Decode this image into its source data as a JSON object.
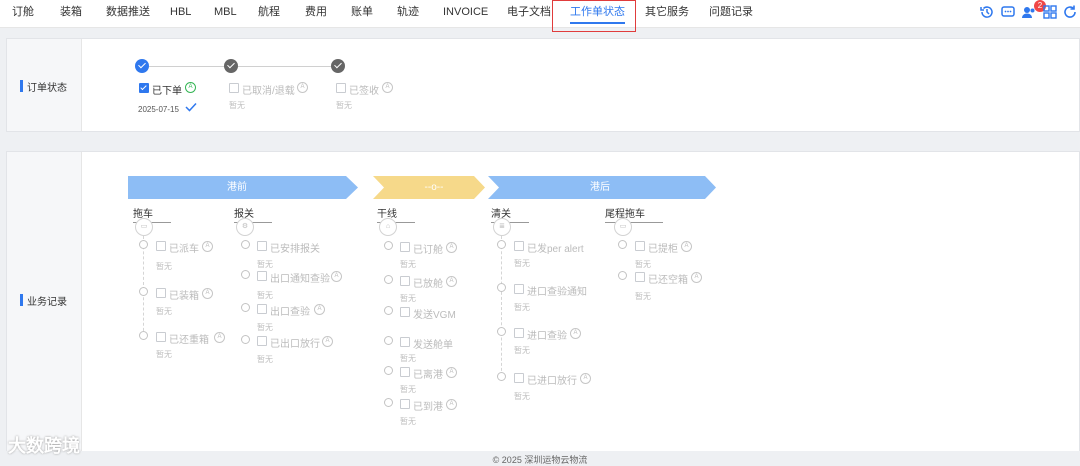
{
  "nav": {
    "tabs": [
      "订舱",
      "装箱",
      "数据推送",
      "HBL",
      "MBL",
      "航程",
      "费用",
      "账单",
      "轨迹",
      "INVOICE",
      "电子文档",
      "工作单状态",
      "其它服务",
      "问题记录"
    ],
    "active_tab": "工作单状态",
    "notification_count": "2"
  },
  "order_status": {
    "label": "订单状态",
    "steps": [
      {
        "label": "已下单",
        "badge": "A",
        "date": "2025-07-15",
        "checked": true
      },
      {
        "label": "已取消/退载",
        "badge": "A",
        "note": "暂无",
        "checked": false
      },
      {
        "label": "已签收",
        "badge": "A",
        "note": "暂无",
        "checked": false
      }
    ]
  },
  "business": {
    "label": "业务记录",
    "phases": [
      "港前",
      "--o--",
      "港后"
    ],
    "lanes": {
      "tow": {
        "title": "拖车",
        "items": [
          "已派车",
          "已装箱",
          "已还重箱"
        ]
      },
      "customs": {
        "title": "报关",
        "items": [
          "已安排报关",
          "出口通知查验",
          "出口查验",
          "已出口放行"
        ]
      },
      "main": {
        "title": "干线",
        "items": [
          "已订舱",
          "已放舱",
          "发送VGM",
          "发送舱单",
          "已离港",
          "已到港"
        ]
      },
      "clear": {
        "title": "清关",
        "items": [
          "已发per alert",
          "进口查验通知",
          "进口查验",
          "已进口放行"
        ]
      },
      "tail": {
        "title": "尾程拖车",
        "items": [
          "已提柜",
          "已还空箱"
        ]
      }
    },
    "badge": "A",
    "empty_note": "暂无"
  },
  "footer": "© 2025 深圳运物云物流",
  "watermark": "大数跨境",
  "colors": {
    "accent": "#2f78ee",
    "phase_blue": "#8dbdf5",
    "phase_yellow": "#f6d98a",
    "highlight": "#e03c3c"
  }
}
